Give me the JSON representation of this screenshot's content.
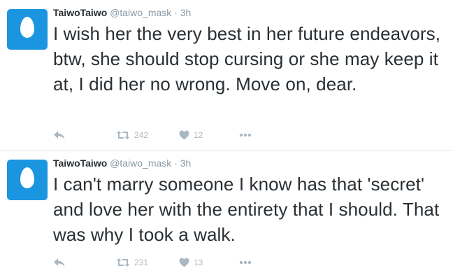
{
  "tweets": [
    {
      "fullname": "TaiwoTaiwo",
      "handle": "@taiwo_mask",
      "separator": "·",
      "time": "3h",
      "text": "I wish her the very best in her future endeavors, btw, she should stop cursing or she may keep it at, I did her no wrong. Move on, dear.",
      "retweets": "242",
      "likes": "12"
    },
    {
      "fullname": "TaiwoTaiwo",
      "handle": "@taiwo_mask",
      "separator": "·",
      "time": "3h",
      "text": "I can't marry someone I know has that 'secret' and love her with the entirety that I should. That was why I took a walk.",
      "retweets": "231",
      "likes": "13"
    }
  ],
  "icons": {
    "reply": "reply-icon",
    "retweet": "retweet-icon",
    "like": "heart-icon",
    "more": "more-icon"
  },
  "colors": {
    "avatar_bg": "#1b95e0",
    "text": "#292f33",
    "meta": "#8899a6",
    "icon": "#aab8c2"
  }
}
